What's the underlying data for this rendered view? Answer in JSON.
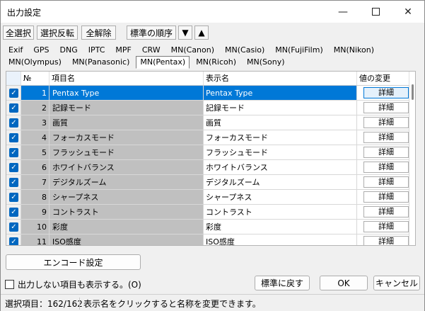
{
  "window": {
    "title": "出力設定",
    "min_icon": "minimize-icon",
    "max_icon": "maximize-icon",
    "close_icon": "close-icon"
  },
  "toolbar": {
    "select_all": "全選択",
    "invert": "選択反転",
    "clear_all": "全解除",
    "standard_order": "標準の順序",
    "down_glyph": "▼",
    "up_glyph": "▲"
  },
  "tabs_row1": [
    "Exif",
    "GPS",
    "DNG",
    "IPTC",
    "MPF",
    "CRW",
    "MN(Canon)",
    "MN(Casio)",
    "MN(FujiFilm)",
    "MN(Nikon)"
  ],
  "tabs_row2": [
    "MN(Olympus)",
    "MN(Panasonic)",
    "MN(Pentax)",
    "MN(Ricoh)",
    "MN(Sony)"
  ],
  "active_tab": "MN(Pentax)",
  "grid": {
    "headers": {
      "no": "№",
      "item": "項目名",
      "display": "表示名",
      "value": "値の変更"
    },
    "detail_label": "詳細",
    "rows": [
      {
        "no": "1",
        "item": "Pentax Type",
        "display": "Pentax Type",
        "selected": true
      },
      {
        "no": "2",
        "item": "記録モード",
        "display": "記録モード"
      },
      {
        "no": "3",
        "item": "画質",
        "display": "画質"
      },
      {
        "no": "4",
        "item": "フォーカスモード",
        "display": "フォーカスモード"
      },
      {
        "no": "5",
        "item": "フラッシュモード",
        "display": "フラッシュモード"
      },
      {
        "no": "6",
        "item": "ホワイトバランス",
        "display": "ホワイトバランス"
      },
      {
        "no": "7",
        "item": "デジタルズーム",
        "display": "デジタルズーム"
      },
      {
        "no": "8",
        "item": "シャープネス",
        "display": "シャープネス"
      },
      {
        "no": "9",
        "item": "コントラスト",
        "display": "コントラスト"
      },
      {
        "no": "10",
        "item": "彩度",
        "display": "彩度"
      },
      {
        "no": "11",
        "item": "ISO感度",
        "display": "ISO感度"
      }
    ]
  },
  "encode_button": "エンコード設定",
  "show_hidden_label": "出力しない項目も表示する。(O)",
  "reset_button": "標準に戻す",
  "ok_button": "OK",
  "cancel_button": "キャンセル",
  "status": {
    "count": "選択項目：162/162",
    "hint": "表示名をクリックすると名称を変更できます。"
  },
  "colors": {
    "selection": "#0078d7",
    "checkbox": "#0067c0",
    "disabled_cell": "#c0c0c0"
  }
}
